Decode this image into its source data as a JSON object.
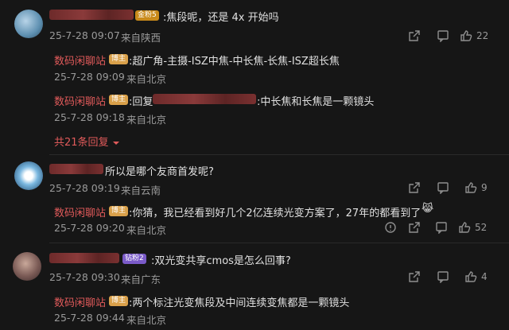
{
  "comments": [
    {
      "badge": "金粉5",
      "text": ":焦段呢，还是 4x 开始吗",
      "time": "25-7-28 09:07",
      "location": "来自陕西",
      "likes": "22",
      "replies": [
        {
          "user": "数码闲聊站",
          "badge": "博主",
          "text": ":超广角-主摄-ISZ中焦-中长焦-长焦-ISZ超长焦",
          "time": "25-7-28 09:09",
          "location": "来自北京"
        },
        {
          "user": "数码闲聊站",
          "badge": "博主",
          "text_prefix": ":回复",
          "text_suffix": ":中长焦和长焦是一颗镜头",
          "time": "25-7-28 09:18",
          "location": "来自北京"
        }
      ],
      "more_replies": "共21条回复"
    },
    {
      "text": "所以是哪个友商首发呢?",
      "time": "25-7-28 09:19",
      "location": "来自云南",
      "likes": "9",
      "replies": [
        {
          "user": "数码闲聊站",
          "badge": "博主",
          "text": ":你猜，我已经看到好几个2亿连续光变方案了，27年的都看到了",
          "time": "25-7-28 09:20",
          "location": "来自北京",
          "likes": "52"
        }
      ]
    },
    {
      "badge": "钻粉2",
      "text": ":双光变共享cmos是怎么回事?",
      "time": "25-7-28 09:30",
      "location": "来自广东",
      "likes": "4",
      "replies": [
        {
          "user": "数码闲聊站",
          "badge": "博主",
          "text": ":两个标注光变焦段及中间连续变焦都是一颗镜头",
          "time": "25-7-28 09:44",
          "location": "来自北京"
        }
      ]
    }
  ],
  "icons": {
    "share": "share-icon",
    "comment": "comment-icon",
    "like": "thumbs-up-icon",
    "info": "info-icon",
    "emoji": "emoji-icon",
    "chevron": "chevron-down-icon"
  }
}
